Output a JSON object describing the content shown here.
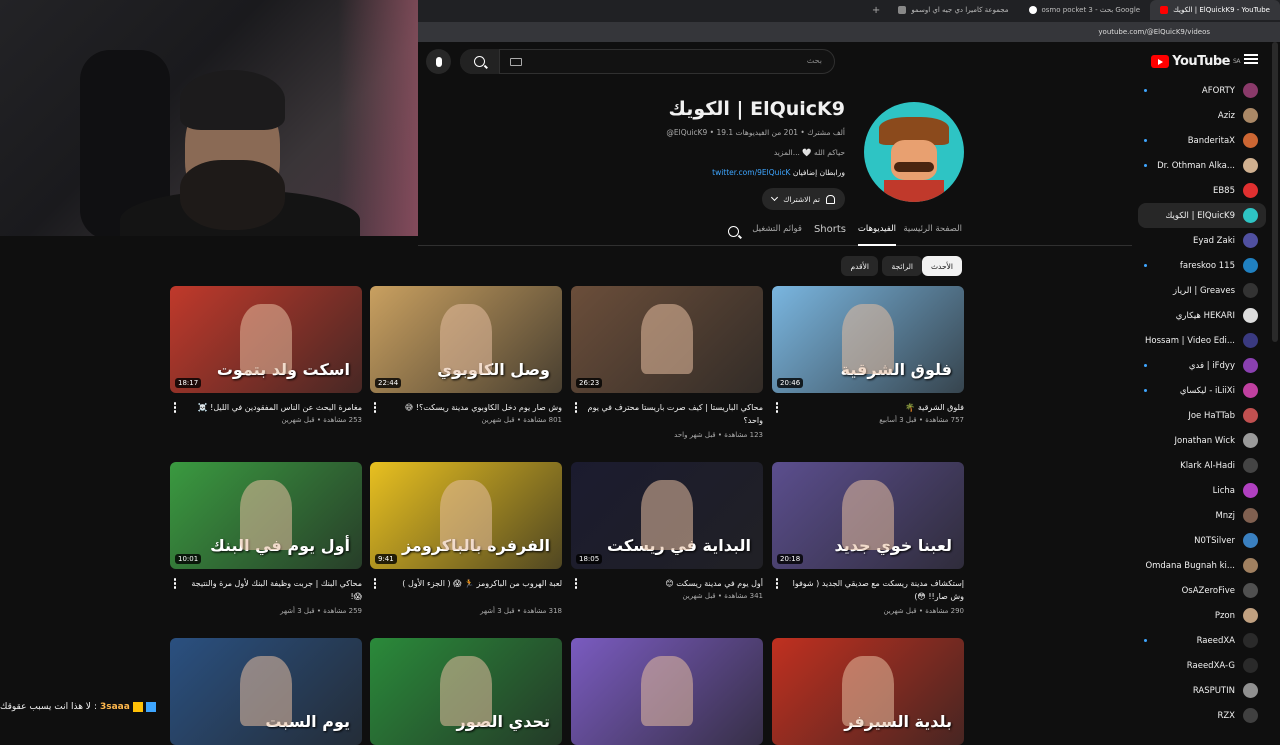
{
  "browser": {
    "tabs": [
      {
        "label": "الكويك | ElQuickK9 - YouTube",
        "active": true
      },
      {
        "label": "osmo pocket 3 - بحث Google",
        "active": false
      },
      {
        "label": "مجموعة كاميرا دي جيه اي اوسمو",
        "active": false
      }
    ],
    "url": "youtube.com/@ElQuicK9/videos"
  },
  "topbar": {
    "search_placeholder": "بحث"
  },
  "logo": {
    "text": "YouTube",
    "country": "SA"
  },
  "channel": {
    "name": "الكويك | ElQuicK9",
    "meta": "@ElQuicK9 • 19.1 ألف مشترك • 201 من الفيديوهات",
    "description": "حياكم الله 🤍 ...المزيد",
    "link": "twitter.com/9ElQuicK",
    "link_suffix": "ورابطان إضافيان",
    "subscribe_label": "تم الاشتراك"
  },
  "channel_tabs": {
    "home": "الصفحة الرئيسية",
    "videos": "الفيديوهات",
    "shorts": "Shorts",
    "playlists": "قوائم التشغيل"
  },
  "filters": [
    "الأحدث",
    "الرائجة",
    "الأقدم"
  ],
  "videos": [
    {
      "title": "فلوق الشرقية 🌴",
      "meta": "757 مشاهدة • قبل 3 أسابيع",
      "duration": "20:46",
      "thumb_text": "فلوق الشرقية",
      "bg": "#7ab6e0"
    },
    {
      "title": "محاكي الباريستا | كيف صرت باريستا محترف في يوم واحد؟",
      "meta": "123 مشاهدة • قبل شهر واحد",
      "duration": "26:23",
      "thumb_text": "",
      "bg": "#6b4e3a"
    },
    {
      "title": "وش صار يوم دخل الكاوبوي مدينة ريسكت؟! 😅",
      "meta": "801 مشاهدة • قبل شهرين",
      "duration": "22:44",
      "thumb_text": "وصل الكاوبوي",
      "bg": "#c9a060"
    },
    {
      "title": "مغامرة البحث عن الناس المفقودين في الليل! ☠️",
      "meta": "253 مشاهدة • قبل شهرين",
      "duration": "18:17",
      "thumb_text": "اسكت ولد بتموت",
      "bg": "#c0392b"
    },
    {
      "title": "إستكشاف مدينة ريسكت مع صديقي الجديد ( شوفوا وش صار!! 😳)",
      "meta": "290 مشاهدة • قبل شهرين",
      "duration": "20:18",
      "thumb_text": "لعبنا خوي جديد",
      "bg": "#5b4e8e"
    },
    {
      "title": "أول يوم في مدينة ريسكت 😊",
      "meta": "341 مشاهدة • قبل شهرين",
      "duration": "18:05",
      "thumb_text": "البداية في ريسكت",
      "bg": "#1b1b2f"
    },
    {
      "title": "لعبة الهروب من الباكرومز 🏃 😱 ( الجزء الأول )",
      "meta": "318 مشاهدة • قبل 3 أشهر",
      "duration": "9:41",
      "thumb_text": "الفرفره بالباكرومز",
      "bg": "#e8c020"
    },
    {
      "title": "محاكي البنك | جربت وظيفة البنك لأول مرة والنتيجة 😱!",
      "meta": "259 مشاهدة • قبل 3 أشهر",
      "duration": "10:01",
      "thumb_text": "أول يوم في البنك",
      "bg": "#3a9a40"
    },
    {
      "title": "",
      "meta": "",
      "duration": "",
      "thumb_text": "بلدية السيرفر",
      "bg": "#c03020"
    },
    {
      "title": "",
      "meta": "",
      "duration": "",
      "thumb_text": "",
      "bg": "#7a5bc0"
    },
    {
      "title": "",
      "meta": "",
      "duration": "",
      "thumb_text": "تحدي الصور",
      "bg": "#2a8a3a"
    },
    {
      "title": "",
      "meta": "",
      "duration": "",
      "thumb_text": "يوم السبت",
      "bg": "#2a5080"
    }
  ],
  "subscriptions": [
    {
      "name": "AFORTY",
      "color": "#8a3a6a",
      "live": true
    },
    {
      "name": "Aziz",
      "color": "#aa8866",
      "live": false
    },
    {
      "name": "BanderitaX",
      "color": "#cc6633",
      "live": true
    },
    {
      "name": "Dr. Othman Alka...",
      "color": "#d0b090",
      "live": true
    },
    {
      "name": "EB85",
      "color": "#e03030",
      "live": false
    },
    {
      "name": "الكويك | ElQuicK9",
      "color": "#2ec4c4",
      "live": false,
      "selected": true
    },
    {
      "name": "Eyad Zaki",
      "color": "#5050a0",
      "live": false
    },
    {
      "name": "fareskoo 115",
      "color": "#2080c0",
      "live": true
    },
    {
      "name": "الرياز | Greaves",
      "color": "#333333",
      "live": false
    },
    {
      "name": "هيكاري HEKARI",
      "color": "#dddddd",
      "live": false
    },
    {
      "name": "Hossam | Video Edi...",
      "color": "#3a3a80",
      "live": false
    },
    {
      "name": "فدي | iFdyy",
      "color": "#8a40b0",
      "live": true
    },
    {
      "name": "ليكساي - iLiiXi",
      "color": "#c040a0",
      "live": true
    },
    {
      "name": "Joe HaTTab",
      "color": "#c05050",
      "live": false
    },
    {
      "name": "Jonathan Wick",
      "color": "#9a9a9a",
      "live": false
    },
    {
      "name": "Klark Al-Hadi",
      "color": "#444444",
      "live": false
    },
    {
      "name": "Licha",
      "color": "#b040c0",
      "live": false
    },
    {
      "name": "Mnzj",
      "color": "#806050",
      "live": false
    },
    {
      "name": "N0TSilver",
      "color": "#3a80c0",
      "live": false
    },
    {
      "name": "Omdana Bugnah ki...",
      "color": "#a08060",
      "live": false
    },
    {
      "name": "OsAZeroFive",
      "color": "#505050",
      "live": false
    },
    {
      "name": "Pzon",
      "color": "#c0a080",
      "live": false
    },
    {
      "name": "RaeedXA",
      "color": "#2a2a2a",
      "live": true
    },
    {
      "name": "RaeedXA-G",
      "color": "#2a2a2a",
      "live": false
    },
    {
      "name": "RASPUTIN",
      "color": "#909090",
      "live": false
    },
    {
      "name": "RZX",
      "color": "#404040",
      "live": false
    }
  ],
  "chat": {
    "username": "3saaa",
    "message": "لا هذا انت يسبب عقوقك"
  },
  "colors": {
    "accent": "#ff0000",
    "link": "#3ea6ff",
    "bg": "#0f0f0f"
  }
}
